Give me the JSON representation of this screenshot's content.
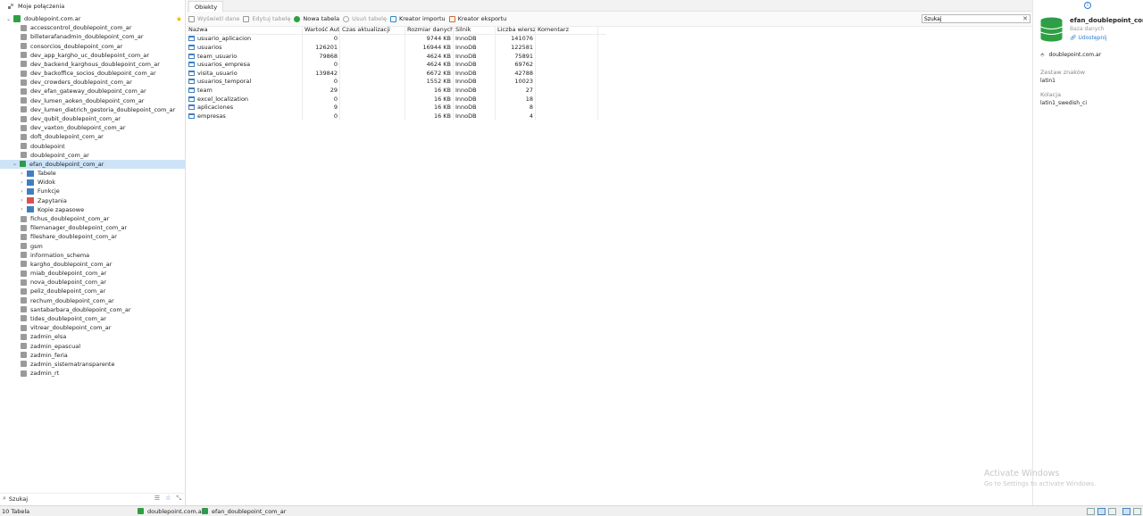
{
  "sidebar": {
    "header": "Moje połączenia",
    "connection": "doublepoint.com.ar",
    "databases_before": [
      "accesscontrol_doublepoint_com_ar",
      "billeterafanadmin_doublepoint_com_ar",
      "consorcios_doublepoint_com_ar",
      "dev_app_kargho_uc_doublepoint_com_ar",
      "dev_backend_karghous_doublepoint_com_ar",
      "dev_backoffice_socios_doublepoint_com_ar",
      "dev_crowders_doublepoint_com_ar",
      "dev_efan_gateway_doublepoint_com_ar",
      "dev_lumen_aoken_doublepoint_com_ar",
      "dev_lumen_dietrich_gestoria_doublepoint_com_ar",
      "dev_qubit_doublepoint_com_ar",
      "dev_vaxton_doublepoint_com_ar",
      "doft_doublepoint_com_ar",
      "doublepoint",
      "doublepoint_com_ar"
    ],
    "open_database": "efan_doublepoint_com_ar",
    "open_children": [
      "Tabele",
      "Widok",
      "Funkcje",
      "Zapytania",
      "Kopie zapasowe"
    ],
    "databases_after": [
      "fichus_doublepoint_com_ar",
      "filemanager_doublepoint_com_ar",
      "fileshare_doublepoint_com_ar",
      "gsm",
      "information_schema",
      "kargho_doublepoint_com_ar",
      "miab_doublepoint_com_ar",
      "nova_doublepoint_com_ar",
      "peliz_doublepoint_com_ar",
      "rechum_doublepoint_com_ar",
      "santabarbara_doublepoint_com_ar",
      "tides_doublepoint_com_ar",
      "vitrear_doublepoint_com_ar",
      "zadmin_elsa",
      "zadmin_epascual",
      "zadmin_feria",
      "zadmin_sistematransparente",
      "zadmin_rt"
    ],
    "search_placeholder": "Szukaj"
  },
  "main": {
    "tab": "Obiekty",
    "toolbar": {
      "view_data": "Wyświetl dane",
      "edit_table": "Edytuj tabelę",
      "new_table": "Nowa tabela",
      "delete_table": "Usuń tabelę",
      "import_wizard": "Kreator importu",
      "export_wizard": "Kreator eksportu"
    },
    "search_value": "Szukaj",
    "columns": [
      "Nazwa",
      "Wartość Aut...",
      "Czas aktualizacji",
      "Rozmiar danych",
      "Silnik",
      "Liczba wierszy",
      "Komentarz"
    ],
    "rows": [
      [
        "usuario_aplicacion",
        "0",
        "",
        "9744 KB",
        "InnoDB",
        "141076",
        ""
      ],
      [
        "usuarios",
        "126201",
        "",
        "16944 KB",
        "InnoDB",
        "122581",
        ""
      ],
      [
        "team_usuario",
        "79868",
        "",
        "4624 KB",
        "InnoDB",
        "75891",
        ""
      ],
      [
        "usuarios_empresa",
        "0",
        "",
        "4624 KB",
        "InnoDB",
        "69762",
        ""
      ],
      [
        "visita_usuario",
        "139842",
        "",
        "6672 KB",
        "InnoDB",
        "42788",
        ""
      ],
      [
        "usuarios_temporal",
        "0",
        "",
        "1552 KB",
        "InnoDB",
        "10023",
        ""
      ],
      [
        "team",
        "29",
        "",
        "16 KB",
        "InnoDB",
        "27",
        ""
      ],
      [
        "excel_localization",
        "0",
        "",
        "16 KB",
        "InnoDB",
        "18",
        ""
      ],
      [
        "aplicaciones",
        "9",
        "",
        "16 KB",
        "InnoDB",
        "8",
        ""
      ],
      [
        "empresas",
        "0",
        "",
        "16 KB",
        "InnoDB",
        "4",
        ""
      ]
    ]
  },
  "info": {
    "name": "efan_doublepoint_com_",
    "type": "Baza danych",
    "share": "Udostępnij",
    "connection": "doublepoint.com.ar",
    "charset_label": "Zestaw znaków",
    "charset_value": "latin1",
    "collation_label": "Kolacja",
    "collation_value": "latin1_swedish_ci"
  },
  "watermark": {
    "title": "Activate Windows",
    "subtitle": "Go to Settings to activate Windows."
  },
  "status": {
    "count": "10 Tabela",
    "connection": "doublepoint.com.ar",
    "database": "efan_doublepoint_com_ar"
  },
  "colors": {
    "selection": "#cde3f7",
    "connection_green": "#2ea043",
    "link_blue": "#2b7bd0"
  }
}
